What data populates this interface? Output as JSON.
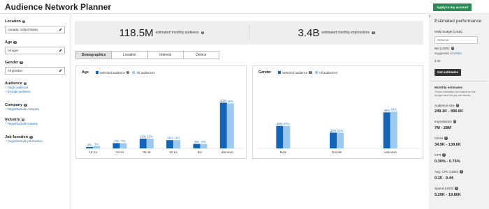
{
  "header": {
    "title": "Audience Network Planner",
    "apply_label": "Apply to my account"
  },
  "sidebar": {
    "location": {
      "label": "Location",
      "value": "Canada, United States"
    },
    "age": {
      "label": "Age",
      "value": "All ages"
    },
    "gender": {
      "label": "Gender",
      "value": "All genders"
    },
    "audience": {
      "label": "Audience",
      "links": [
        "+ Target audience",
        "+ Exclude audience"
      ]
    },
    "company": {
      "label": "Company",
      "links": [
        "+ Target/Exclude company"
      ]
    },
    "industry": {
      "label": "Industry",
      "links": [
        "+ Target/Exclude industry"
      ]
    },
    "job_function": {
      "label": "Job function",
      "links": [
        "+ Target/Exclude job function"
      ]
    }
  },
  "summary": {
    "audience_value": "118.5M",
    "audience_label": "estimated monthly audience",
    "impressions_value": "3.4B",
    "impressions_label": "estimated monthly impressions"
  },
  "tabs": [
    "Demographics",
    "Location",
    "Interest",
    "Device"
  ],
  "legend": {
    "selected": "Selected audience",
    "all": "All audiences"
  },
  "colors": {
    "selected": "#1464b8",
    "all": "#9bc9ef",
    "apply_button": "#2e8a55"
  },
  "chart_data": [
    {
      "type": "bar",
      "title": "Age",
      "categories": [
        "18-24",
        "25-34",
        "35-49",
        "50-64",
        "65+",
        "Unknown"
      ],
      "series": [
        {
          "name": "Selected audience",
          "values": [
            2,
            7,
            13,
            11,
            6,
            61
          ]
        },
        {
          "name": "All audiences",
          "values": [
            3,
            7,
            13,
            11,
            6,
            60
          ]
        }
      ],
      "value_labels": [
        [
          "2%",
          "3%"
        ],
        [
          "7%",
          "7%"
        ],
        [
          "13%",
          "13%"
        ],
        [
          "11%",
          "11%"
        ],
        [
          "6%",
          "6%"
        ],
        [
          "61%",
          "60%"
        ]
      ],
      "ylim": [
        0,
        65
      ]
    },
    {
      "type": "bar",
      "title": "Gender",
      "categories": [
        "Male",
        "Female",
        "Unknown"
      ],
      "series": [
        {
          "name": "Selected audience",
          "values": [
            30,
            21,
            48
          ]
        },
        {
          "name": "All audiences",
          "values": [
            30,
            21,
            49
          ]
        }
      ],
      "value_labels": [
        [
          "30%",
          "30%"
        ],
        [
          "21%",
          "21%"
        ],
        [
          "48%",
          "49%"
        ]
      ],
      "ylim": [
        0,
        65
      ]
    }
  ],
  "estimates": {
    "title": "Estimated performance",
    "daily_budget_label": "Daily budget (USD):",
    "daily_budget_placeholder": "Optional",
    "bid_label": "Bid (USD):",
    "bid_suggested": "Suggested",
    "bid_separator": " | ",
    "bid_custom": "Custom",
    "bid_value": "$ 95",
    "get_button": "Get estimates",
    "monthly_title": "Monthly estimates",
    "monthly_note": "These estimates are based on the budget and bid you set above.",
    "metrics": [
      {
        "label": "Audience size",
        "value": "249.1K - 996.6K"
      },
      {
        "label": "Impressions",
        "value": "7M - 28M"
      },
      {
        "label": "Clicks",
        "value": "34.9K - 139.6K"
      },
      {
        "label": "CTR",
        "value": "0.30% - 0.76%"
      },
      {
        "label": "Avg. CPC (USD)",
        "value": "0.15 - 0.44"
      },
      {
        "label": "Spend (USD)",
        "value": "5.20K - 19.80K"
      }
    ]
  }
}
